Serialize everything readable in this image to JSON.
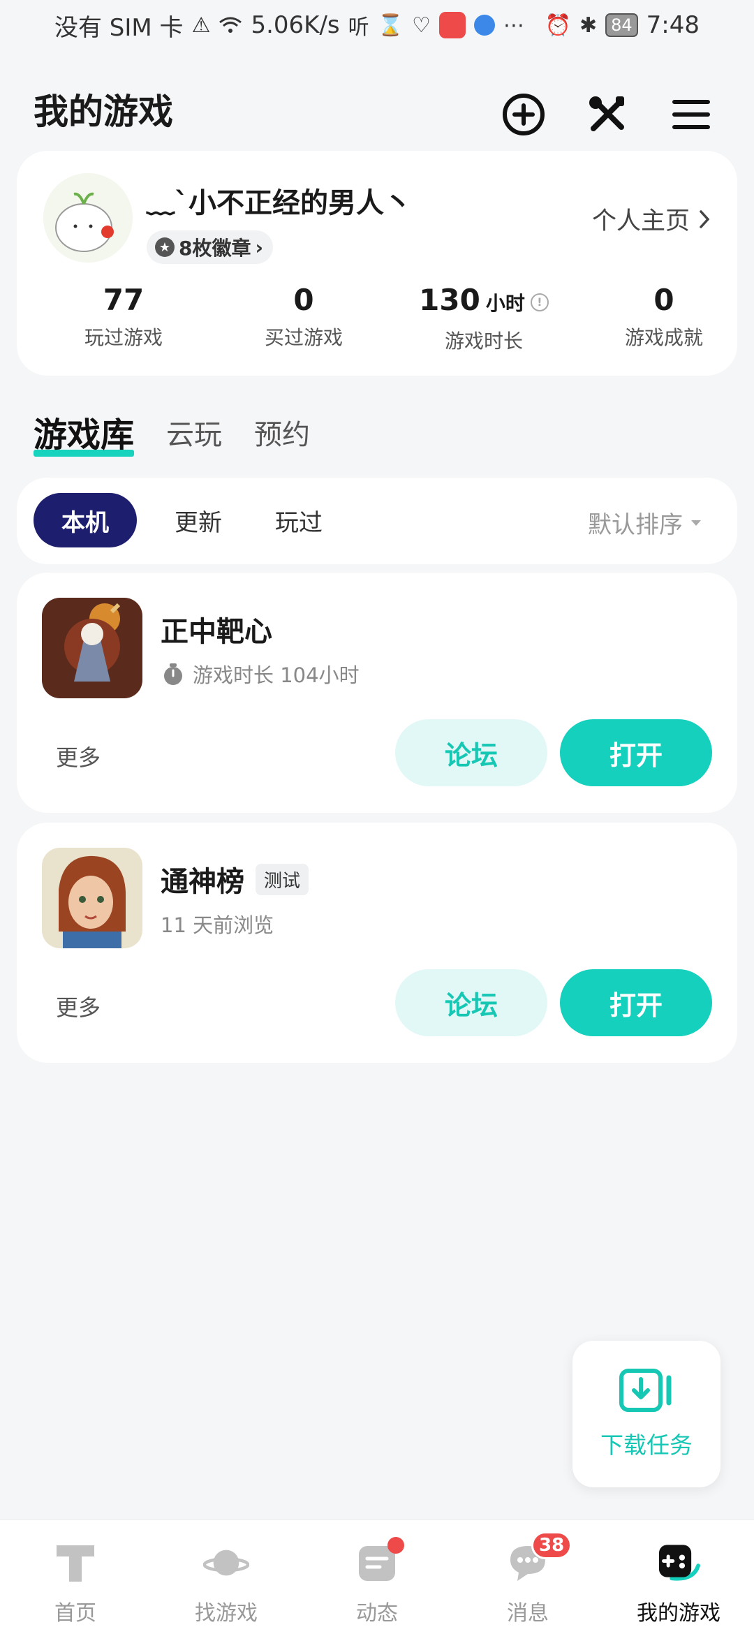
{
  "status_bar": {
    "carrier": "没有 SIM 卡",
    "speed": "5.06K/s",
    "battery": "84",
    "time": "7:48",
    "icons": [
      "sim-alert-icon",
      "wifi-icon",
      "listen-icon",
      "hourglass-icon",
      "heart-icon",
      "app-icon",
      "globe-icon",
      "more-icon",
      "alarm-icon",
      "bluetooth-icon",
      "battery-icon"
    ]
  },
  "header": {
    "title": "我的游戏"
  },
  "profile": {
    "nickname": "﹏ˋ小不正经的男人丶",
    "badges": "8枚徽章",
    "homepage": "个人主页",
    "stats": [
      {
        "value": "77",
        "label": "玩过游戏"
      },
      {
        "value": "0",
        "label": "买过游戏"
      },
      {
        "value": "130",
        "unit": "小时",
        "label": "游戏时长"
      },
      {
        "value": "0",
        "label": "游戏成就"
      }
    ]
  },
  "library_tabs": [
    "游戏库",
    "云玩",
    "预约"
  ],
  "filters": {
    "items": [
      "本机",
      "更新",
      "玩过"
    ],
    "sort": "默认排序"
  },
  "games": [
    {
      "name": "正中靶心",
      "subtitle": "游戏时长 104小时",
      "more": "更多",
      "forum": "论坛",
      "open": "打开"
    },
    {
      "name": "通神榜",
      "tag": "测试",
      "subtitle": "11 天前浏览",
      "more": "更多",
      "forum": "论坛",
      "open": "打开"
    }
  ],
  "download_fab": {
    "label": "下载任务"
  },
  "bottom_nav": [
    {
      "label": "首页"
    },
    {
      "label": "找游戏"
    },
    {
      "label": "动态"
    },
    {
      "label": "消息",
      "badge": "38"
    },
    {
      "label": "我的游戏"
    }
  ],
  "colors": {
    "accent": "#14d0bc",
    "accent_light": "#e2f8f6",
    "navy": "#1e1e6e",
    "badge_red": "#ee4a4a"
  }
}
